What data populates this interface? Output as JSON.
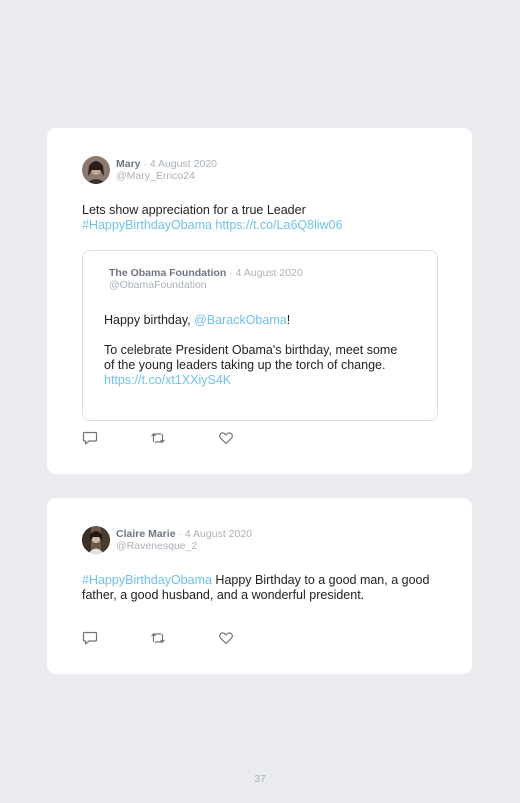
{
  "tweets": [
    {
      "author_name": "Mary",
      "separator": "·",
      "date": "4 August 2020",
      "handle": "@Mary_Errico24",
      "text_plain": "Lets show appreciation for a true Leader",
      "hashtag": "#HappyBirthdayObama",
      "url": "https://t.co/La6Q8liw06",
      "quoted": {
        "author_name": "The Obama Foundation",
        "separator": "·",
        "date": "4 August 2020",
        "handle": "@ObamaFoundation",
        "line1_prefix": "Happy birthday, ",
        "mention": "@BarackObama",
        "line1_suffix": "!",
        "paragraph": "To celebrate President Obama's birthday, meet some of the young leaders taking up the torch of change.",
        "url": "https://t.co/xt1XXiyS4K"
      },
      "actions": [
        "reply-icon",
        "retweet-icon",
        "like-icon"
      ]
    },
    {
      "author_name": "Claire Marie",
      "separator": "·",
      "date": "4 August 2020",
      "handle": "@Ravenesque_2",
      "hashtag": "#HappyBirthdayObama",
      "text_plain": " Happy Birthday to a good man, a good father, a good husband, and a wonderful president.",
      "actions": [
        "reply-icon",
        "retweet-icon",
        "like-icon"
      ]
    }
  ],
  "page_number": "37",
  "colors": {
    "background": "#e9ebee",
    "card": "#ffffff",
    "link": "#6fc2e8",
    "muted": "#a9b1b9",
    "name": "#6d7680"
  }
}
